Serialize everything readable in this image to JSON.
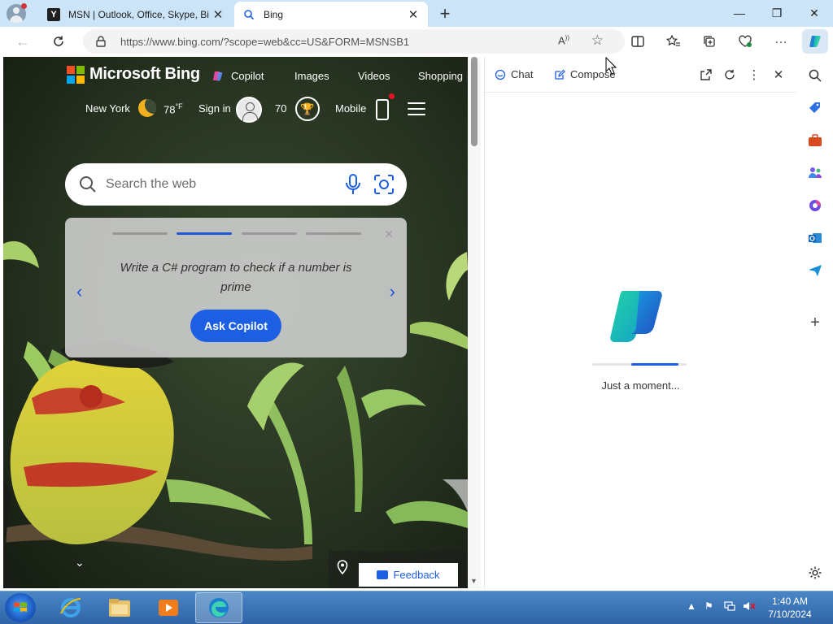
{
  "browser": {
    "tabs": [
      {
        "title": "MSN | Outlook, Office, Skype, Bi",
        "favicon": "msn-icon"
      },
      {
        "title": "Bing",
        "favicon": "bing-search-icon"
      }
    ],
    "url": "https://www.bing.com/?scope=web&cc=US&FORM=MSNSB1",
    "read_aloud_label": "A"
  },
  "bing": {
    "brand": "Microsoft Bing",
    "nav": {
      "copilot": "Copilot",
      "images": "Images",
      "videos": "Videos",
      "shopping": "Shopping"
    },
    "weather": {
      "city": "New York",
      "temp": "78",
      "unit": "°F"
    },
    "sign_in": "Sign in",
    "rewards_points": "70",
    "mobile": "Mobile",
    "search_placeholder": "Search the web",
    "carousel": {
      "prompt": "Write a C# program to check if a number is prime",
      "button": "Ask Copilot",
      "active_index": 1,
      "count": 4
    },
    "feedback": "Feedback"
  },
  "copilot_pane": {
    "tabs": {
      "chat": "Chat",
      "compose": "Compose"
    },
    "loading_text": "Just a moment..."
  },
  "taskbar": {
    "time": "1:40 AM",
    "date": "7/10/2024"
  },
  "colors": {
    "accent": "#1d5fe2",
    "tabbar": "#cce4f7",
    "taskbar": "#2f65a8"
  }
}
